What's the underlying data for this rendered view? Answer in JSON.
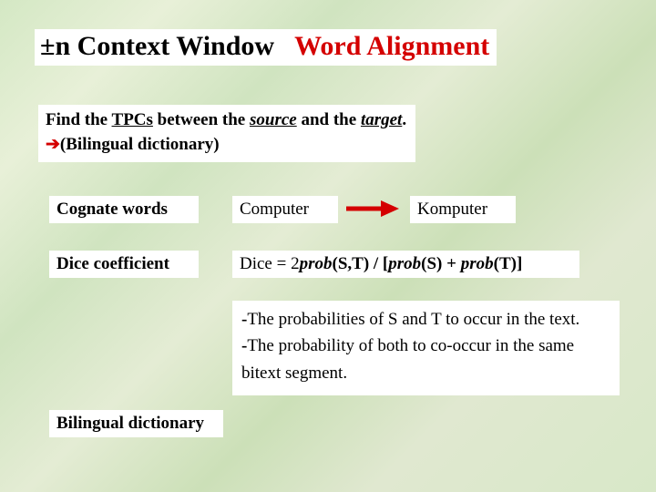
{
  "title": {
    "part1": "±n Context Window",
    "part2": "Word Alignment"
  },
  "intro": {
    "line1_a": "Find the ",
    "line1_tpcs": "TPCs",
    "line1_b": " between the ",
    "line1_source": "source",
    "line1_c": " and the ",
    "line1_target": "target",
    "line1_d": ".",
    "line2_arrow": "➔",
    "line2_text": "(Bilingual dictionary)"
  },
  "cognate_label": "Cognate words",
  "computer_label": "Computer",
  "komputer_label": "Komputer",
  "dicecoef_label": "Dice coefficient",
  "formula": {
    "a": "Dice = 2",
    "b": "prob",
    "c": "(S,T) / [",
    "d": "prob",
    "e": "(S) + ",
    "f": "prob",
    "g": "(T)]"
  },
  "explain": {
    "dash": "-",
    "l1": "The probabilities of S and T to occur in the text.",
    "l2a": "The probability of both to co-occur in the same",
    "l2b": "bitext segment."
  },
  "bilingual_label": "Bilingual dictionary"
}
